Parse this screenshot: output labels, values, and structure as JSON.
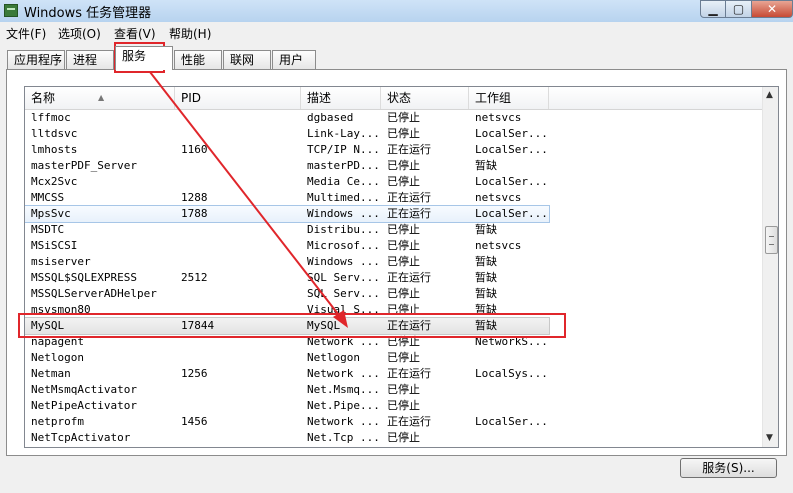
{
  "window": {
    "title": "Windows 任务管理器",
    "controls": {
      "minimize": "▁",
      "maximize": "▢",
      "close": "✕"
    }
  },
  "menu": [
    "文件(F)",
    "选项(O)",
    "查看(V)",
    "帮助(H)"
  ],
  "tabs": [
    "应用程序",
    "进程",
    "服务",
    "性能",
    "联网",
    "用户"
  ],
  "active_tab": "服务",
  "columns": {
    "name": "名称",
    "pid": "PID",
    "desc": "描述",
    "status": "状态",
    "group": "工作组"
  },
  "rows": [
    {
      "name": "lffmoc",
      "pid": "",
      "desc": "dgbased",
      "status": "已停止",
      "group": "netsvcs"
    },
    {
      "name": "lltdsvc",
      "pid": "",
      "desc": "Link-Lay...",
      "status": "已停止",
      "group": "LocalSer..."
    },
    {
      "name": "lmhosts",
      "pid": "1160",
      "desc": "TCP/IP N...",
      "status": "正在运行",
      "group": "LocalSer..."
    },
    {
      "name": "masterPDF_Server",
      "pid": "",
      "desc": "masterPD...",
      "status": "已停止",
      "group": "暂缺"
    },
    {
      "name": "Mcx2Svc",
      "pid": "",
      "desc": "Media Ce...",
      "status": "已停止",
      "group": "LocalSer..."
    },
    {
      "name": "MMCSS",
      "pid": "1288",
      "desc": "Multimed...",
      "status": "正在运行",
      "group": "netsvcs"
    },
    {
      "name": "MpsSvc",
      "pid": "1788",
      "desc": "Windows ...",
      "status": "正在运行",
      "group": "LocalSer..."
    },
    {
      "name": "MSDTC",
      "pid": "",
      "desc": "Distribu...",
      "status": "已停止",
      "group": "暂缺"
    },
    {
      "name": "MSiSCSI",
      "pid": "",
      "desc": "Microsof...",
      "status": "已停止",
      "group": "netsvcs"
    },
    {
      "name": "msiserver",
      "pid": "",
      "desc": "Windows ...",
      "status": "已停止",
      "group": "暂缺"
    },
    {
      "name": "MSSQL$SQLEXPRESS",
      "pid": "2512",
      "desc": "SQL Serv...",
      "status": "正在运行",
      "group": "暂缺"
    },
    {
      "name": "MSSQLServerADHelper",
      "pid": "",
      "desc": "SQL Serv...",
      "status": "已停止",
      "group": "暂缺"
    },
    {
      "name": "msvsmon80",
      "pid": "",
      "desc": "Visual S...",
      "status": "已停止",
      "group": "暂缺"
    },
    {
      "name": "MySQL",
      "pid": "17844",
      "desc": "MySQL",
      "status": "正在运行",
      "group": "暂缺"
    },
    {
      "name": "napagent",
      "pid": "",
      "desc": "Network ...",
      "status": "已停止",
      "group": "NetworkS..."
    },
    {
      "name": "Netlogon",
      "pid": "",
      "desc": "Netlogon",
      "status": "已停止",
      "group": ""
    },
    {
      "name": "Netman",
      "pid": "1256",
      "desc": "Network ...",
      "status": "正在运行",
      "group": "LocalSys..."
    },
    {
      "name": "NetMsmqActivator",
      "pid": "",
      "desc": "Net.Msmq...",
      "status": "已停止",
      "group": ""
    },
    {
      "name": "NetPipeActivator",
      "pid": "",
      "desc": "Net.Pipe...",
      "status": "已停止",
      "group": ""
    },
    {
      "name": "netprofm",
      "pid": "1456",
      "desc": "Network ...",
      "status": "正在运行",
      "group": "LocalSer..."
    },
    {
      "name": "NetTcpActivator",
      "pid": "",
      "desc": "Net.Tcp ...",
      "status": "已停止",
      "group": ""
    }
  ],
  "services_button": "服务(S)...",
  "colors": {
    "annotation": "#e0262b",
    "accent": "#3399ff"
  }
}
